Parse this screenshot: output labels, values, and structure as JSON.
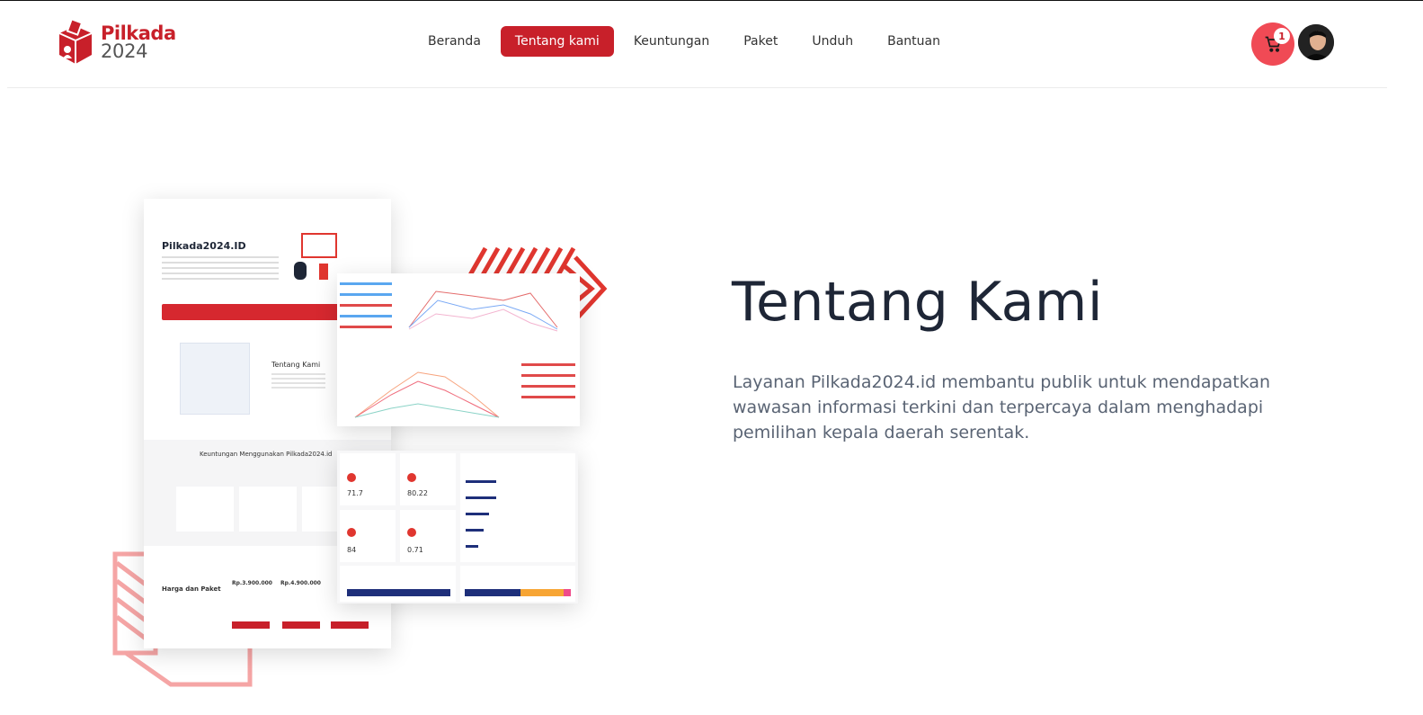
{
  "brand": {
    "name_top": "Pilkada",
    "name_bottom": "2024",
    "colors": {
      "primary": "#c8202a",
      "cart": "#f04a55",
      "heading": "#1e2636",
      "body_text": "#5a6474"
    }
  },
  "nav": {
    "items": [
      {
        "label": "Beranda",
        "active": false
      },
      {
        "label": "Tentang kami",
        "active": true
      },
      {
        "label": "Keuntungan",
        "active": false
      },
      {
        "label": "Paket",
        "active": false
      },
      {
        "label": "Unduh",
        "active": false
      },
      {
        "label": "Bantuan",
        "active": false
      }
    ]
  },
  "cart": {
    "count": "1",
    "icon": "cart-icon"
  },
  "user": {
    "icon": "avatar"
  },
  "hero": {
    "title": "Tentang Kami",
    "description": "Layanan Pilkada2024.id membantu publik untuk mendapatkan wawasan informasi terkini dan terpercaya dalam menghadapi pemilihan kepala daerah serentak."
  },
  "illustration": {
    "mock_brand": "Pilkada2024.ID",
    "mock_about": "Tentang Kami",
    "mock_benefits": "Keuntungan Menggunakan Pilkada2024.id",
    "mock_pricing": "Harga dan Paket",
    "stats": [
      "71.7",
      "80.22",
      "84",
      "0.71"
    ],
    "prices": [
      "Rp.3.900.000",
      "Rp.4.900.000"
    ]
  }
}
